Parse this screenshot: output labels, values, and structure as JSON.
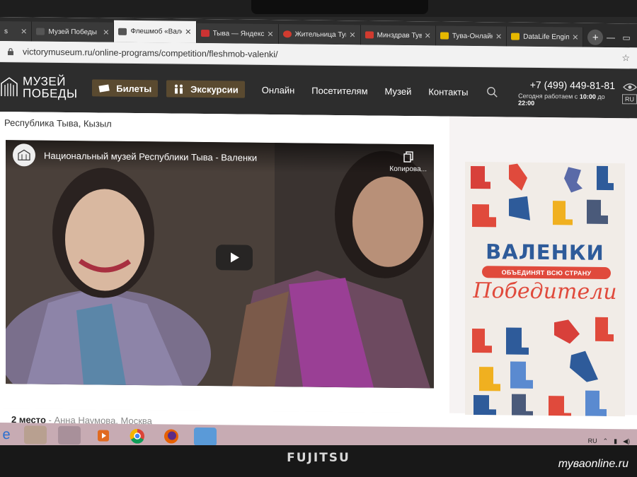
{
  "browser": {
    "tabs": [
      {
        "label": "s",
        "color": "#888888"
      },
      {
        "label": "Музей Победы",
        "color": "#555555"
      },
      {
        "label": "Флешмоб «Валенки»",
        "color": "#555555",
        "active": true
      },
      {
        "label": "Тыва — Яндекс",
        "color": "#cc3333"
      },
      {
        "label": "Жительница Тувы",
        "color": "#d23b2f"
      },
      {
        "label": "Минздрав Тувы",
        "color": "#d23b2f"
      },
      {
        "label": "Тува-Онлайн",
        "color": "#e6b800"
      },
      {
        "label": "DataLife Engine",
        "color": "#e6b800"
      }
    ],
    "url": "victorymuseum.ru/online-programs/competition/fleshmob-valenki/"
  },
  "site": {
    "logo_line1": "МУЗЕЙ",
    "logo_line2": "ПОБЕДЫ",
    "tickets_label": "Билеты",
    "excursions_label": "Экскурсии",
    "nav": [
      "Онлайн",
      "Посетителям",
      "Музей",
      "Контакты"
    ],
    "phone": "+7 (499) 449-81-81",
    "hours_prefix": "Сегодня работаем с ",
    "hours_from": "10:00",
    "hours_mid": " до ",
    "hours_to": "22:00",
    "lang": "RU"
  },
  "main": {
    "region": "Республика Тыва, Кызыл",
    "video_title": "Национальный музей Республики Тыва - Валенки",
    "copy_label": "Копирова...",
    "second_place_label": "2 место",
    "second_place_name": " - Анна Наумова, Москва"
  },
  "poster": {
    "title": "ВАЛЕНКИ",
    "subtitle": "ОБЪЕДИНЯТ ВСЮ СТРАНУ",
    "winners": "Победители"
  },
  "taskbar": {
    "lang": "RU"
  },
  "device": {
    "brand": "FUJITSU"
  },
  "watermark": "туваonline.ru"
}
